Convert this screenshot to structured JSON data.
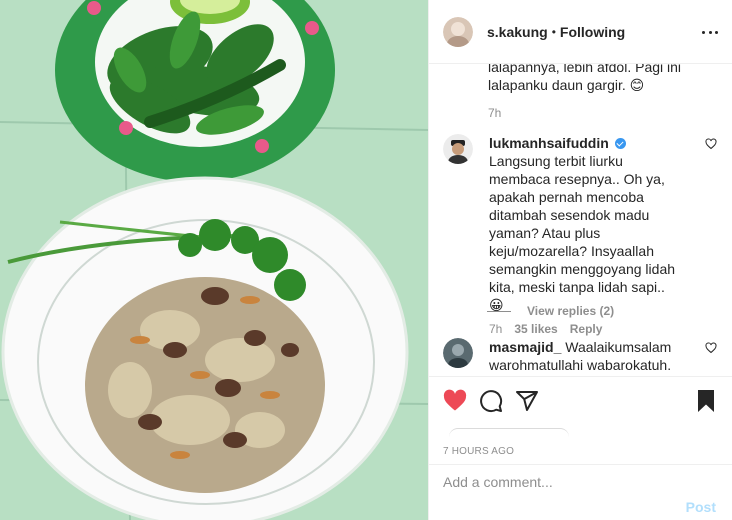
{
  "post": {
    "photo_alt": "Fried rice topped with fried shallots on a white plate, with a plate of raw vegetables, leaves, chili and lime"
  },
  "header": {
    "username": "s.kakung",
    "separator": "•",
    "follow_status": "Following",
    "more_icon": "more-horizontal-icon"
  },
  "comments": {
    "previous_partial": {
      "text": "lalapannya, lebih afdol. Pagi ini lalapanku daun gargir.",
      "emoji": "😊",
      "time": "7h"
    },
    "items": [
      {
        "username": "lukmanhsaifuddin",
        "verified": true,
        "text": "Langsung terbit liurku membaca resepnya.. Oh ya, apakah pernah mencoba ditambah sesendok madu yaman? Atau plus keju/mozarella? Insyaallah semangkin menggoyang lidah kita, meski tanpa lidah sapi..",
        "emoji": "😀",
        "time": "7h",
        "likes": "35 likes",
        "reply_label": "Reply",
        "view_replies": "View replies (2)"
      },
      {
        "username": "masmajid_",
        "verified": false,
        "text": "Waalaikumsalam warohmatullahi wabarokatuh."
      }
    ]
  },
  "actions": {
    "like_icon": "heart-filled-icon",
    "comment_icon": "comment-icon",
    "share_icon": "share-icon",
    "save_icon": "bookmark-filled-icon",
    "like_color": "#ed4956"
  },
  "timestamp": "7 HOURS AGO",
  "add_comment": {
    "placeholder": "Add a comment...",
    "post_label": "Post"
  }
}
